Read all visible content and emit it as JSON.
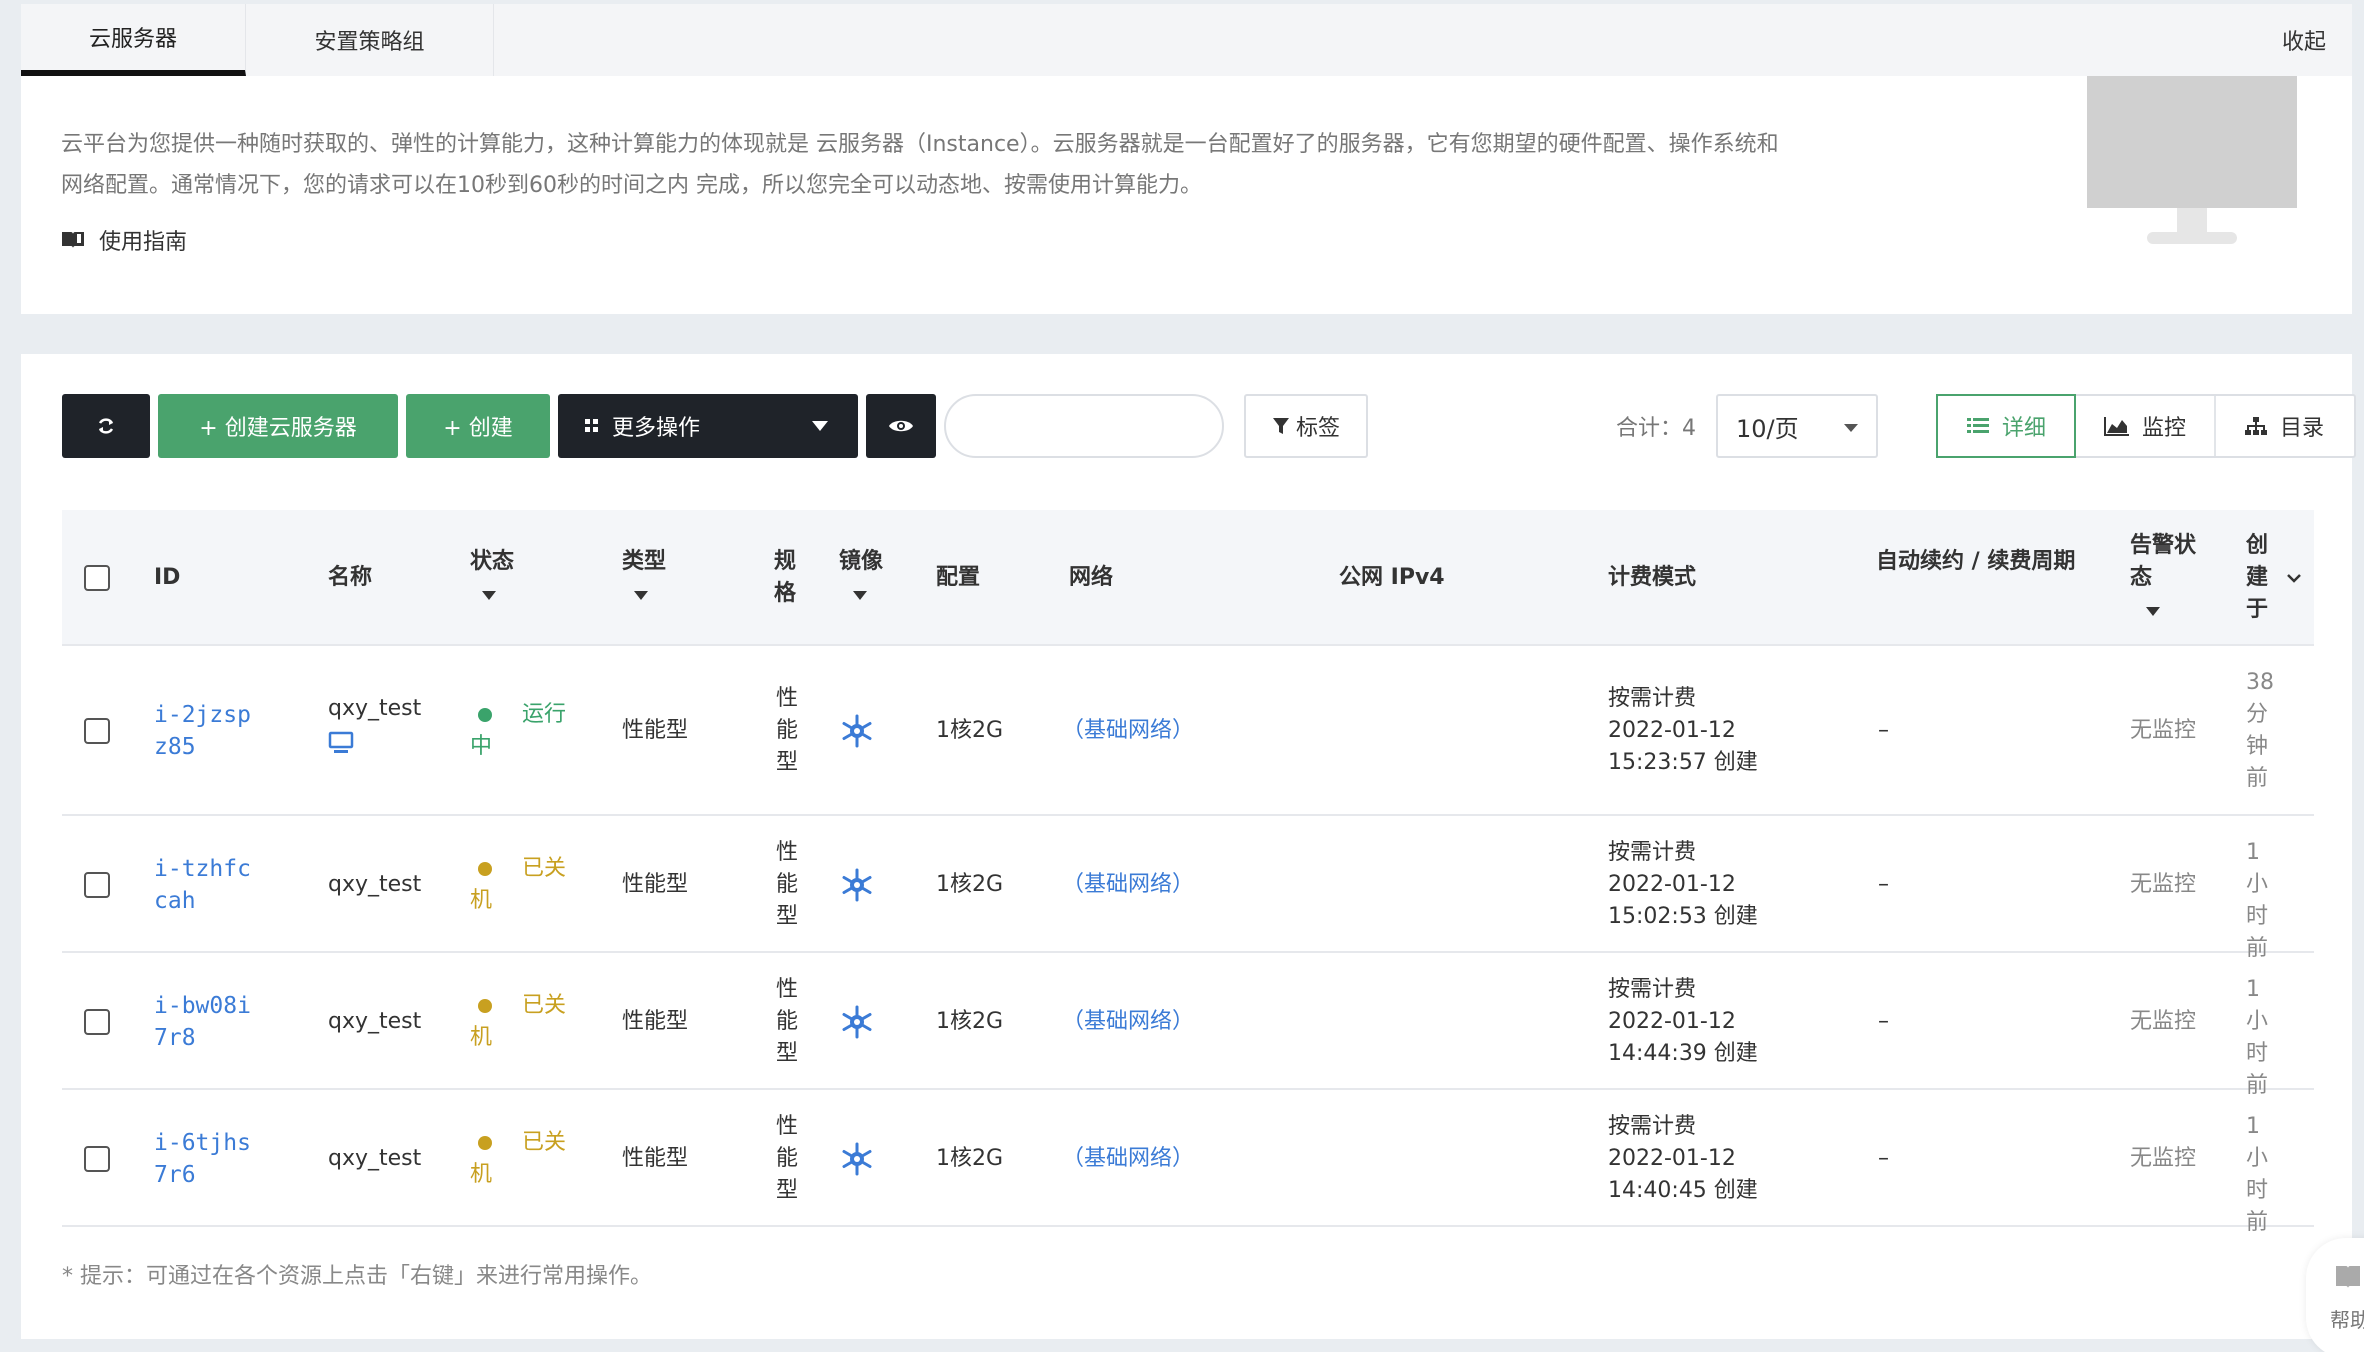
{
  "tabs": [
    {
      "label": "云服务器"
    },
    {
      "label": "安置策略组"
    }
  ],
  "collapse_label": "收起",
  "intro": {
    "line1": "云平台为您提供一种随时获取的、弹性的计算能力，这种计算能力的体现就是 云服务器（Instance）。云服务器就是一台配置好了的服务器，它有您期望的硬件配置、操作系统和",
    "line2": "网络配置。通常情况下，您的请求可以在10秒到60秒的时间之内 完成，所以您完全可以动态地、按需使用计算能力。",
    "guide_label": "使用指南"
  },
  "toolbar": {
    "create_instance": "+ 创建云服务器",
    "create": "+ 创建",
    "more_actions": "更多操作",
    "search_placeholder": "",
    "tag": "标签",
    "total": "合计：4",
    "page_size": "10/页",
    "view_detail": "详细",
    "view_monitor": "监控",
    "view_directory": "目录"
  },
  "colors": {
    "green": "#4aa36d",
    "dark": "#1f2329",
    "link": "#3b7bd6",
    "running": "#3aa36b",
    "stopped": "#c8a020"
  },
  "table": {
    "headers": {
      "id": "ID",
      "name": "名称",
      "status": "状态",
      "type": "类型",
      "spec": "规格",
      "image": "镜像",
      "config": "配置",
      "network": "网络",
      "public_ip": "公网 IPv4",
      "billing": "计费模式",
      "renew": "自动续约 / 续费周期",
      "alarm": "告警状态",
      "created": "创建于"
    },
    "rows": [
      {
        "id_line1": "i-2jzsp",
        "id_line2": "z85",
        "name": "qxy_test",
        "status_line1": "运行",
        "status_line2": "中",
        "status_color": "#3aa36b",
        "type": "性能型",
        "spec": [
          "性",
          "能",
          "型"
        ],
        "config": "1核2G",
        "network": "（基础网络）",
        "billing1": "按需计费",
        "billing2": "2022-01-12",
        "billing3": "15:23:57 创建",
        "renew": "–",
        "alarm": "无监控",
        "created": [
          "38",
          "分",
          "钟",
          "前"
        ]
      },
      {
        "id_line1": "i-tzhfc",
        "id_line2": "cah",
        "name": "qxy_test",
        "status_line1": "已关",
        "status_line2": "机",
        "status_color": "#c8a020",
        "type": "性能型",
        "spec": [
          "性",
          "能",
          "型"
        ],
        "config": "1核2G",
        "network": "（基础网络）",
        "billing1": "按需计费",
        "billing2": "2022-01-12",
        "billing3": "15:02:53 创建",
        "renew": "–",
        "alarm": "无监控",
        "created": [
          "1 小",
          "时",
          "前"
        ]
      },
      {
        "id_line1": "i-bw08i",
        "id_line2": "7r8",
        "name": "qxy_test",
        "status_line1": "已关",
        "status_line2": "机",
        "status_color": "#c8a020",
        "type": "性能型",
        "spec": [
          "性",
          "能",
          "型"
        ],
        "config": "1核2G",
        "network": "（基础网络）",
        "billing1": "按需计费",
        "billing2": "2022-01-12",
        "billing3": "14:44:39 创建",
        "renew": "–",
        "alarm": "无监控",
        "created": [
          "1 小",
          "时",
          "前"
        ]
      },
      {
        "id_line1": "i-6tjhs",
        "id_line2": "7r6",
        "name": "qxy_test",
        "status_line1": "已关",
        "status_line2": "机",
        "status_color": "#c8a020",
        "type": "性能型",
        "spec": [
          "性",
          "能",
          "型"
        ],
        "config": "1核2G",
        "network": "（基础网络）",
        "billing1": "按需计费",
        "billing2": "2022-01-12",
        "billing3": "14:40:45 创建",
        "renew": "–",
        "alarm": "无监控",
        "created": [
          "1 小",
          "时",
          "前"
        ]
      }
    ]
  },
  "hint": "* 提示：可通过在各个资源上点击「右键」来进行常用操作。",
  "help_label": "帮助"
}
